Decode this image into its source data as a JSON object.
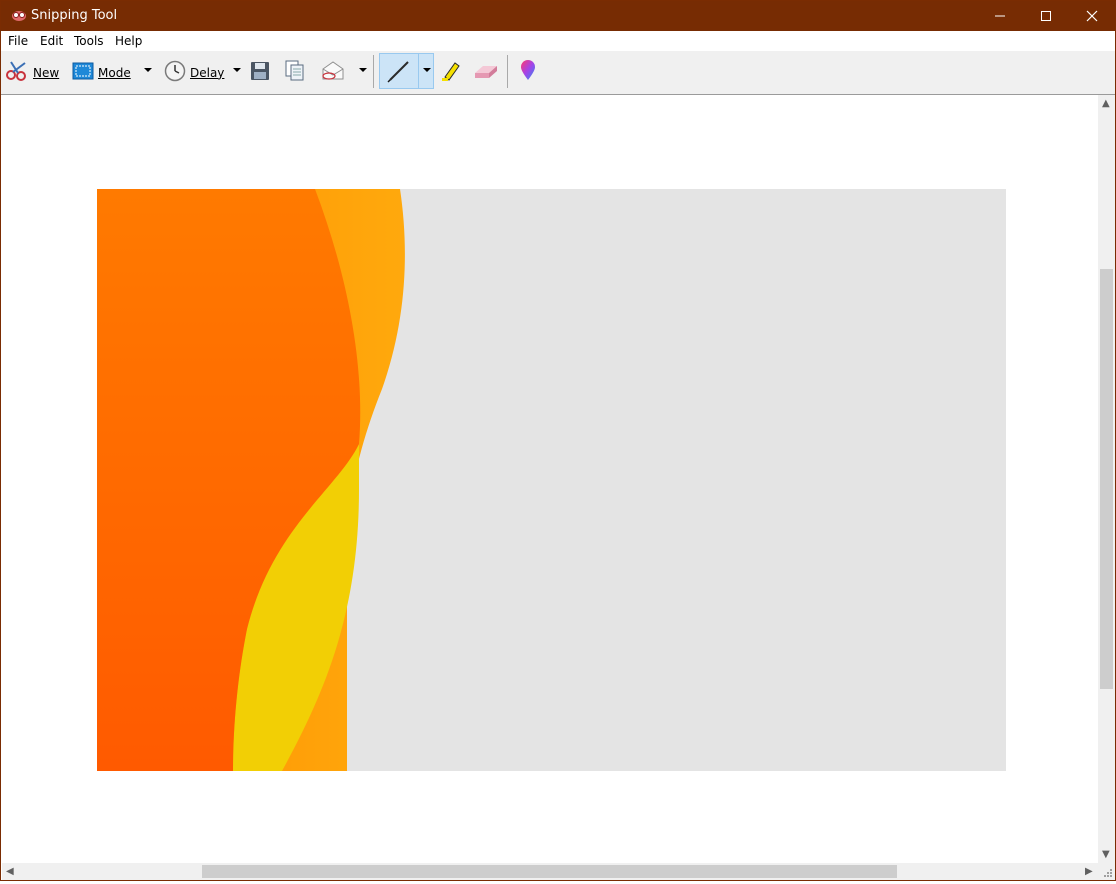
{
  "window": {
    "title": "Snipping Tool"
  },
  "menu": [
    "File",
    "Edit",
    "Tools",
    "Help"
  ],
  "toolbar": {
    "new_label": "New",
    "mode_label": "Mode",
    "delay_label": "Delay"
  },
  "colors": {
    "titlebar": "#772c03",
    "snip_background": "#e4e4e4",
    "snip_orange": "#ff6a00",
    "snip_light_orange": "#ff9f0a",
    "snip_yellow": "#f2cf05"
  }
}
